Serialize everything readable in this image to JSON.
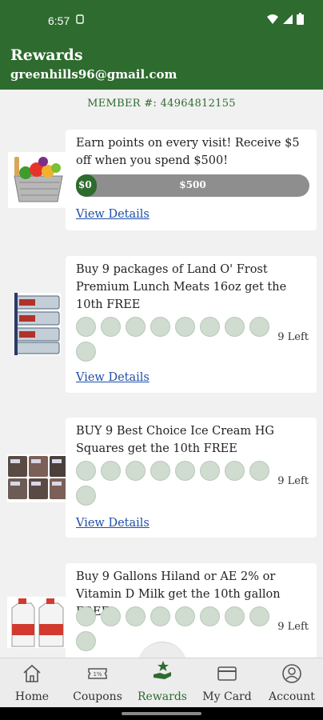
{
  "status": {
    "time": "6:57",
    "sim_icon": "sim-icon"
  },
  "header": {
    "title": "Rewards",
    "email": "greenhills96@gmail.com"
  },
  "member": {
    "text": "MEMBER #: 44964812155"
  },
  "rewards": [
    {
      "title": "Earn points on every visit! Receive $5 off when you spend $500!",
      "progress_start": "$0",
      "progress_end": "$500",
      "progress_fraction": 0.04,
      "link": "View Details"
    },
    {
      "title": "Buy 9 packages of Land O' Frost Premium Lunch Meats 16oz get the 10th FREE",
      "punches_total": 9,
      "left": "9 Left",
      "link": "View Details"
    },
    {
      "title": "BUY 9 Best Choice Ice Cream HG Squares get the 10th FREE",
      "punches_total": 9,
      "left": "9 Left",
      "link": "View Details"
    },
    {
      "title": "Buy 9 Gallons Hiland or AE 2% or Vitamin D Milk get the 10th gallon FREE",
      "punches_total": 9,
      "left": "9 Left"
    }
  ],
  "nav": {
    "home": "Home",
    "coupons": "Coupons",
    "rewards": "Rewards",
    "card": "My Card",
    "account": "Account",
    "active_color": "#2e6b2e"
  }
}
